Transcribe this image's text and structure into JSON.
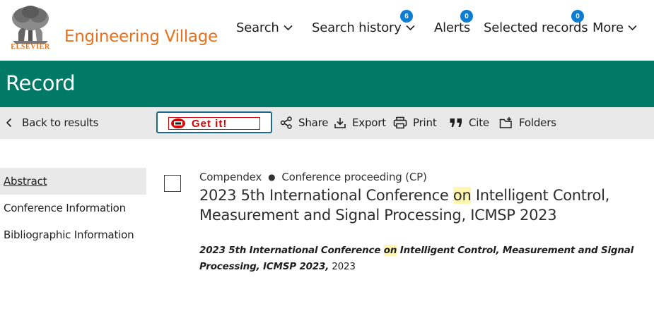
{
  "header": {
    "logo_text": "ELSEVIER",
    "brand": "Engineering Village",
    "nav": [
      {
        "label": "Search",
        "has_menu": true
      },
      {
        "label": "Search history",
        "has_menu": true,
        "badge": "6"
      },
      {
        "label": "Alerts",
        "has_menu": false,
        "badge": "0"
      },
      {
        "label": "Selected records",
        "has_menu": false,
        "badge": "0"
      },
      {
        "label": "More",
        "has_menu": true
      }
    ]
  },
  "band": {
    "title": "Record"
  },
  "toolbar": {
    "back": "Back to results",
    "getit": "Get it!",
    "share": "Share",
    "export": "Export",
    "print": "Print",
    "cite": "Cite",
    "folders": "Folders"
  },
  "sidenav": [
    {
      "label": "Abstract",
      "active": true
    },
    {
      "label": "Conference Information",
      "active": false
    },
    {
      "label": "Bibliographic Information",
      "active": false
    }
  ],
  "record": {
    "database": "Compendex",
    "doc_type": "Conference proceeding (CP)",
    "title_pre": "2023 5th International Conference ",
    "title_hl": "on",
    "title_post": " Intelligent Control, Measurement and Signal Processing, ICMSP 2023",
    "source_pre": "2023 5th International Conference ",
    "source_hl": "on",
    "source_post": " Intelligent Control, Measurement and Signal Processing, ICMSP 2023,",
    "year": " 2023"
  },
  "colors": {
    "brand_orange": "#e9711c",
    "band_green": "#007a66",
    "badge_blue": "#0c7dd0",
    "highlight": "#fff5b0"
  }
}
